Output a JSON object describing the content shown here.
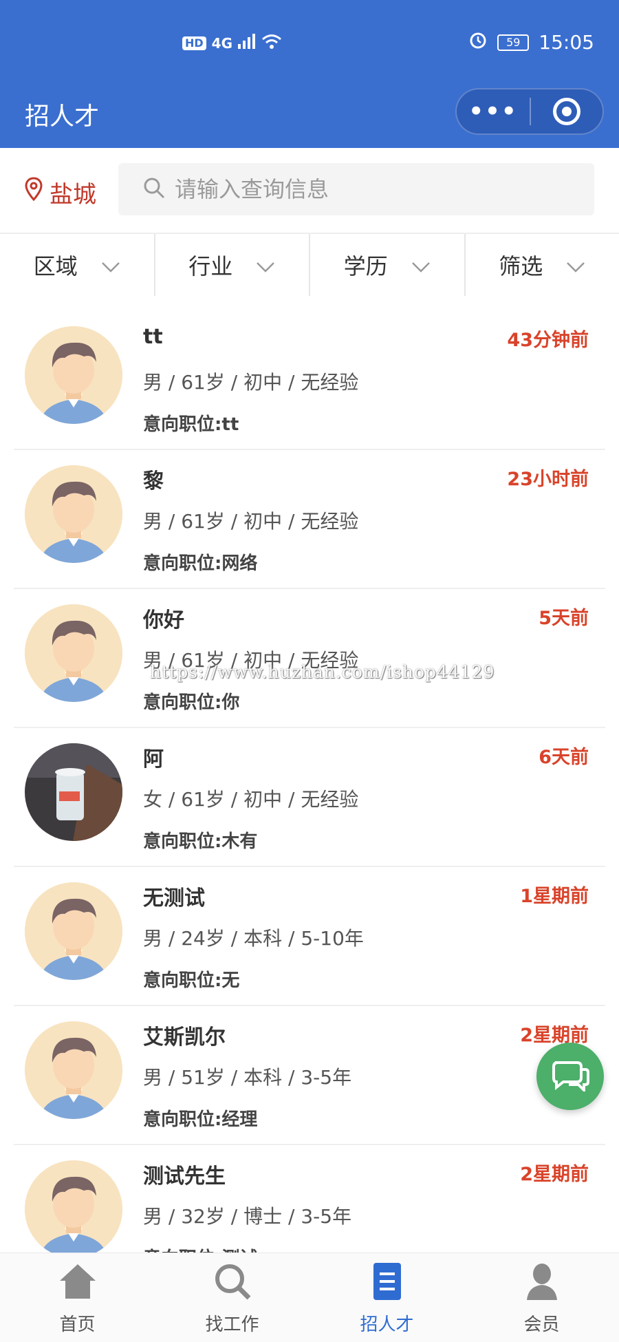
{
  "status_bar": {
    "network": "4G",
    "hd": "HD",
    "battery": "59",
    "time": "15:05"
  },
  "header": {
    "title": "招人才"
  },
  "search": {
    "city": "盐城",
    "placeholder": "请输入查询信息"
  },
  "filters": [
    {
      "label": "区域"
    },
    {
      "label": "行业"
    },
    {
      "label": "学历"
    },
    {
      "label": "筛选"
    }
  ],
  "candidates": [
    {
      "name": "tt",
      "time": "43分钟前",
      "info": "男 / 61岁 / 初中 / 无经验",
      "intent": "意向职位:tt",
      "avatar": "default-avatar"
    },
    {
      "name": "黎",
      "time": "23小时前",
      "info": "男 / 61岁 / 初中 / 无经验",
      "intent": "意向职位:网络",
      "avatar": "default-avatar"
    },
    {
      "name": "你好",
      "time": "5天前",
      "info": "男 / 61岁 / 初中 / 无经验",
      "intent": "意向职位:你",
      "avatar": "default-avatar"
    },
    {
      "name": "阿",
      "time": "6天前",
      "info": "女 / 61岁 / 初中 / 无经验",
      "intent": "意向职位:木有",
      "avatar": "photo-avatar"
    },
    {
      "name": "无测试",
      "time": "1星期前",
      "info": "男 / 24岁 / 本科 / 5-10年",
      "intent": "意向职位:无",
      "avatar": "default-avatar"
    },
    {
      "name": "艾斯凯尔",
      "time": "2星期前",
      "info": "男 / 51岁 / 本科 / 3-5年",
      "intent": "意向职位:经理",
      "avatar": "default-avatar"
    },
    {
      "name": "测试先生",
      "time": "2星期前",
      "info": "男 / 32岁 / 博士 / 3-5年",
      "intent": "意向职位:测试",
      "avatar": "default-avatar"
    }
  ],
  "watermark": "https://www.huzhan.com/ishop44129",
  "tabbar": [
    {
      "label": "首页",
      "icon": "home-icon"
    },
    {
      "label": "找工作",
      "icon": "search-icon"
    },
    {
      "label": "招人才",
      "icon": "document-icon",
      "active": true
    },
    {
      "label": "会员",
      "icon": "user-icon"
    }
  ],
  "colors": {
    "brand": "#3a6fd0",
    "accent_red": "#d9432a",
    "chat_green": "#4caf6a",
    "tab_active": "#2f6cd2"
  }
}
